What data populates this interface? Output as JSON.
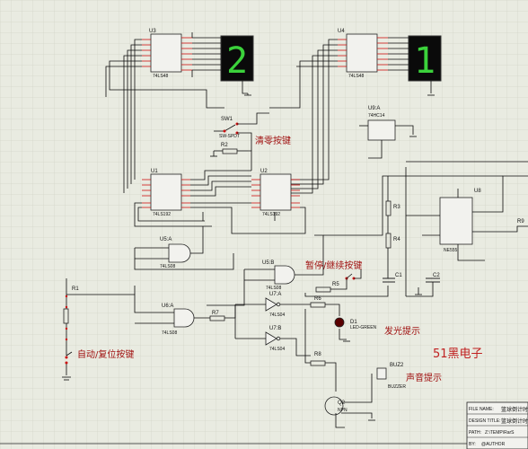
{
  "labels": {
    "clear_key": "清零按键",
    "pause_key": "暂停/继续按键",
    "auto_reset_key": "自动/复位按键",
    "led_hint": "发光提示",
    "sound_hint": "声音提示",
    "brand": "51黑电子"
  },
  "components": {
    "U3": "U3",
    "U4": "U4",
    "U1": "U1",
    "U2": "U2",
    "U5A": "U5:A",
    "U5B": "U5:B",
    "U6A": "U6:A",
    "U7A": "U7:A",
    "U7B": "U7:B",
    "U9A": "U9:A",
    "U8": "U8",
    "SW1": "SW1",
    "R1": "R1",
    "R2": "R2",
    "R3": "R3",
    "R4": "R4",
    "R5": "R5",
    "R6": "R6",
    "R7": "R7",
    "R8": "R8",
    "R9": "R9",
    "C1": "C1",
    "C2": "C2",
    "D1": "D1",
    "Q2": "Q2",
    "BUZ2": "BUZ2"
  },
  "parts": {
    "ic48": "74LS48",
    "ic192": "74LS192",
    "ic08": "74LS08",
    "ic04": "74LS04",
    "ic14": "74HC14",
    "ne555": "NE555",
    "sw": "SW-SPDT",
    "buzzer": "BUZZER",
    "led": "LED-GREEN",
    "npn": "NPN"
  },
  "display": {
    "left_digit": "2",
    "right_digit": "1"
  },
  "title_block": {
    "row1_label": "FILE NAME:",
    "row1_value": "篮球倒计时",
    "row2_label": "DESIGN TITLE:",
    "row2_value": "篮球倒计时",
    "row3_label": "PATH:",
    "row3_value": "Z:\\TEMP\\RarS",
    "row4_label": "BY:",
    "row4_value": "@AUTHOR"
  },
  "colors": {
    "wire": "#0a0a0a",
    "pin": "#cc1111",
    "chip": "#111111",
    "seg_on": "#3bd23b",
    "seg_off": "#123012"
  }
}
